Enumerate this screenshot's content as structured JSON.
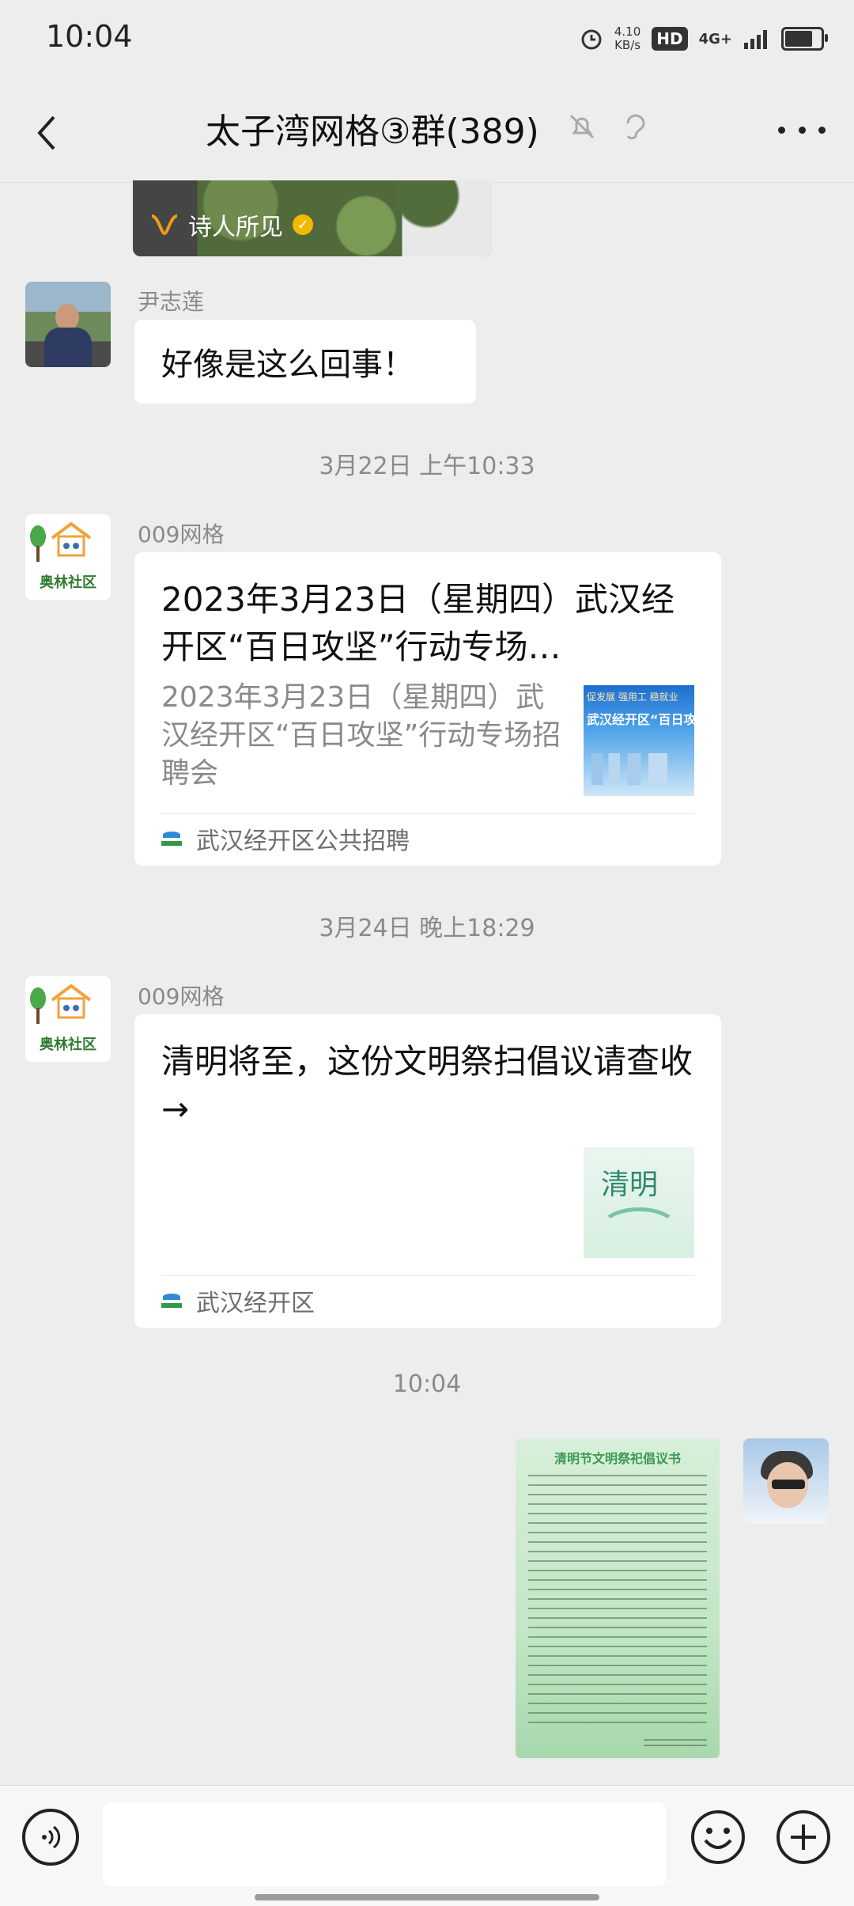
{
  "status_bar": {
    "time": "10:04",
    "speed_value": "4.10",
    "speed_unit": "KB/s",
    "hd_label": "HD",
    "network_label": "4G+"
  },
  "header": {
    "title": "太子湾网格③群(389)",
    "back_icon": "chevron-left-icon",
    "mute_icon": "bell-muted-icon",
    "ear_icon": "ear-icon",
    "more_icon": "more-dots-icon"
  },
  "partial_card": {
    "source": "诗人所见",
    "verified_mark": "✓"
  },
  "messages": [
    {
      "sender": "尹志莲",
      "text": "好像是这么回事！"
    },
    {
      "timestamp": "3月22日 上午10:33"
    },
    {
      "sender": "009网格",
      "card_title": "2023年3月23日（星期四）武汉经开区“百日攻坚”行动专场…",
      "card_desc": "2023年3月23日（星期四）武汉经开区“百日攻坚”行动专场招聘会",
      "source": "武汉经开区公共招聘"
    },
    {
      "timestamp": "3月24日 晚上18:29"
    },
    {
      "sender": "009网格",
      "card_title": "清明将至，这份文明祭扫倡议请查收→",
      "source": "武汉经开区"
    },
    {
      "timestamp": "10:04"
    },
    {
      "image_title": "清明节文明祭祀倡议书"
    }
  ],
  "avatars": {
    "aolin_logo_text": "奥林社区"
  },
  "thumbs": {
    "job_line1": "促发展 强用工 稳就业",
    "job_line2": "武汉经开区“百日攻",
    "qingming": "清明"
  },
  "input_bar": {
    "placeholder": "",
    "voice_icon": "voice-icon",
    "emoji_icon": "emoji-icon",
    "plus_icon": "plus-icon"
  }
}
